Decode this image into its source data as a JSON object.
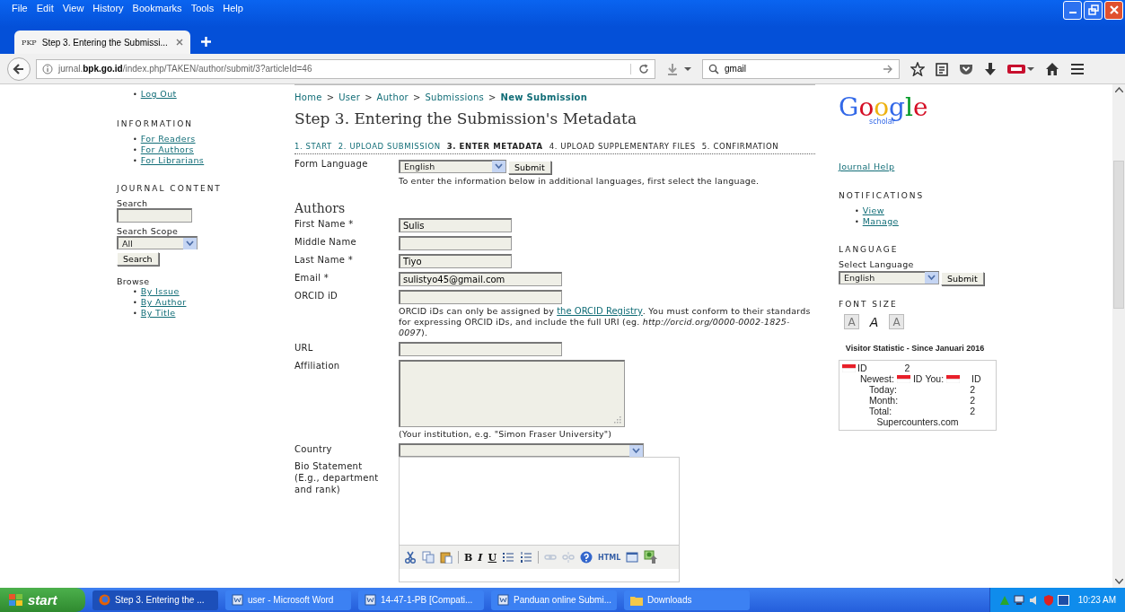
{
  "browser": {
    "menu": [
      "File",
      "Edit",
      "View",
      "History",
      "Bookmarks",
      "Tools",
      "Help"
    ],
    "tab": {
      "favicon": "PKP",
      "title": "Step 3. Entering the Submissi..."
    },
    "address": "jurnal.**bpk.go.id**/index.php/TAKEN/author/submit/3?articleId=46",
    "search": "gmail"
  },
  "left_sidebar": {
    "user_links": [
      {
        "bullet": "•",
        "label": "Log Out"
      }
    ],
    "information": {
      "heading": "INFORMATION",
      "links": [
        {
          "bullet": "•",
          "label": "For Readers"
        },
        {
          "bullet": "•",
          "label": "For Authors"
        },
        {
          "bullet": "•",
          "label": "For Librarians"
        }
      ]
    },
    "journal_content": {
      "heading": "JOURNAL CONTENT",
      "search_label": "Search",
      "scope_label": "Search Scope",
      "scope_value": "All",
      "search_button": "Search",
      "browse_label": "Browse",
      "browse_links": [
        {
          "bullet": "•",
          "label": "By Issue"
        },
        {
          "bullet": "•",
          "label": "By Author"
        },
        {
          "bullet": "•",
          "label": "By Title"
        }
      ]
    }
  },
  "main": {
    "breadcrumbs": [
      {
        "label": "Home",
        "current": false
      },
      {
        "label": "User",
        "current": false
      },
      {
        "label": "Author",
        "current": false
      },
      {
        "label": "Submissions",
        "current": false
      },
      {
        "label": "New Submission",
        "current": true
      }
    ],
    "separator": ">",
    "title": "Step 3. Entering the Submission's Metadata",
    "steps": [
      {
        "label": "1. START",
        "selected": false,
        "done": true
      },
      {
        "label": "2. UPLOAD SUBMISSION",
        "selected": false,
        "done": true
      },
      {
        "label": "3. ENTER METADATA",
        "selected": true,
        "done": false
      },
      {
        "label": "4. UPLOAD SUPPLEMENTARY FILES",
        "selected": false,
        "done": false
      },
      {
        "label": "5. CONFIRMATION",
        "selected": false,
        "done": false
      }
    ],
    "form_language": {
      "label": "Form Language",
      "value": "English",
      "button": "Submit",
      "hint": "To enter the information below in additional languages, first select the language."
    },
    "authors_heading": "Authors",
    "fields": [
      {
        "kind": "short",
        "label": "First Name *",
        "value": "Sulis"
      },
      {
        "kind": "short",
        "label": "Middle Name"
      },
      {
        "kind": "short",
        "label": "Last Name *",
        "value": "Tiyo"
      },
      {
        "kind": "long",
        "label": "Email *",
        "value": "sulistyo45@gmail.com"
      },
      {
        "kind": "long",
        "label": "ORCID iD",
        "hint_before": "ORCID iDs can only be assigned by ",
        "hint_link": "the ORCID Registry",
        "hint_after": ". You must conform to their standards for expressing ORCID iDs, and include the full URI (eg. *http://orcid.org/0000-0002-1825-0097*)."
      },
      {
        "kind": "long",
        "label": "URL"
      },
      {
        "kind": "textarea",
        "label": "Affiliation",
        "hint": "(Your institution, e.g. \"Simon Fraser University\")"
      },
      {
        "kind": "select",
        "label": "Country"
      },
      {
        "kind": "editor",
        "label": "Bio Statement (E.g., department and rank)"
      }
    ],
    "editor_toolbar": [
      {
        "kind": "cut"
      },
      {
        "kind": "copy"
      },
      {
        "kind": "paste"
      },
      {
        "kind": "separator"
      },
      {
        "kind": "bold",
        "label": "B"
      },
      {
        "kind": "italic",
        "label": "I"
      },
      {
        "kind": "underline",
        "label": "U"
      },
      {
        "kind": "bullets"
      },
      {
        "kind": "numbers"
      },
      {
        "kind": "separator"
      },
      {
        "kind": "link"
      },
      {
        "kind": "unlink"
      },
      {
        "kind": "help"
      },
      {
        "kind": "html",
        "label": "HTML"
      },
      {
        "kind": "code"
      },
      {
        "kind": "image"
      }
    ]
  },
  "right_sidebar": {
    "logo": {
      "main": "Google",
      "sub": "scholar"
    },
    "journal_help": "Journal Help",
    "notifications": {
      "heading": "NOTIFICATIONS",
      "links": [
        {
          "bullet": "•",
          "label": "View"
        },
        {
          "bullet": "•",
          "label": "Manage"
        }
      ]
    },
    "language": {
      "heading": "LANGUAGE",
      "label": "Select Language",
      "value": "English",
      "button": "Submit"
    },
    "font_size": {
      "heading": "FONT SIZE",
      "buttons": [
        {
          "label": "A",
          "selected": false
        },
        {
          "label": "A",
          "selected": true
        },
        {
          "label": "A",
          "selected": false
        }
      ]
    },
    "visitor_title": "Visitor Statistic - Since Januari 2016",
    "counter": {
      "code": "ID",
      "count": "2",
      "newest_label": "Newest:",
      "newest_code": "ID",
      "you_label": "You:",
      "you_code": "ID",
      "stats": [
        {
          "label": "Today:",
          "value": "2"
        },
        {
          "label": "Month:",
          "value": "2"
        },
        {
          "label": "Total:",
          "value": "2"
        }
      ],
      "footer": "Supercounters.com"
    }
  },
  "taskbar": {
    "start": "start",
    "items": [
      {
        "kind": "firefox",
        "label": "Step 3. Entering the ...",
        "selected": true
      },
      {
        "kind": "word",
        "label": "user - Microsoft Word",
        "selected": false
      },
      {
        "kind": "word",
        "label": "14-47-1-PB [Compati...",
        "selected": false
      },
      {
        "kind": "word",
        "label": "Panduan online Submi...",
        "selected": false
      },
      {
        "kind": "folder",
        "label": "Downloads",
        "selected": false
      }
    ],
    "clock": "10:23 AM"
  }
}
